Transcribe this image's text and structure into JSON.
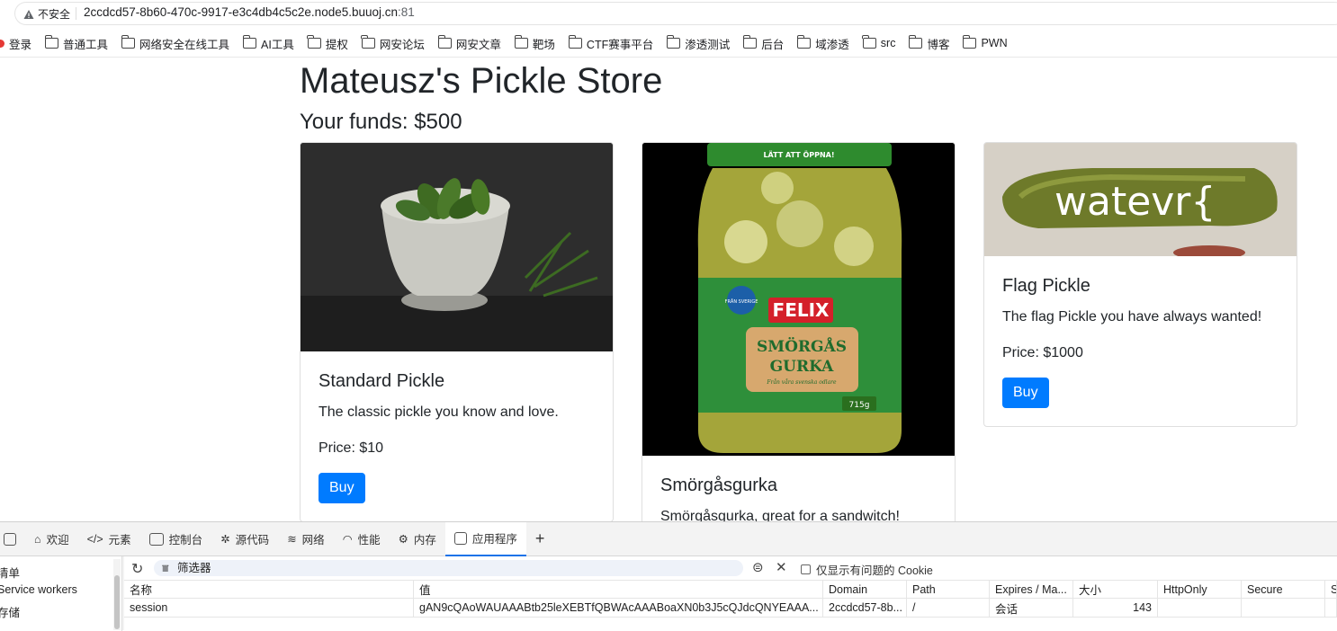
{
  "browser": {
    "security_label": "不安全",
    "url_host": "2ccdcd57-8b60-470c-9917-e3c4db4c5c2e.node5.buuoj.cn",
    "url_port": ":81"
  },
  "bookmarks": [
    {
      "label": "登录"
    },
    {
      "label": "普通工具"
    },
    {
      "label": "网络安全在线工具"
    },
    {
      "label": "AI工具"
    },
    {
      "label": "提权"
    },
    {
      "label": "网安论坛"
    },
    {
      "label": "网安文章"
    },
    {
      "label": "靶场"
    },
    {
      "label": "CTF赛事平台"
    },
    {
      "label": "渗透测试"
    },
    {
      "label": "后台"
    },
    {
      "label": "域渗透"
    },
    {
      "label": "src"
    },
    {
      "label": "博客"
    },
    {
      "label": "PWN"
    }
  ],
  "page": {
    "title": "Mateusz's Pickle Store",
    "funds": "Your funds: $500",
    "products": [
      {
        "name": "Standard Pickle",
        "desc": "The classic pickle you know and love.",
        "price": "Price: $10",
        "buy": "Buy"
      },
      {
        "name": "Smörgåsgurka",
        "desc": "Smörgåsgurka, great for a sandwitch!",
        "jar_brand": "FELIX",
        "jar_line1": "SMÖRGÅS",
        "jar_line2": "GURKA",
        "jar_sub": "Från våra svenska odlare",
        "jar_badge": "FRÅN SVERIGE",
        "jar_weight": "715g",
        "jar_lid": "LÄTT ATT ÖPPNA!"
      },
      {
        "name": "Flag Pickle",
        "desc": "The flag Pickle you have always wanted!",
        "price": "Price: $1000",
        "buy": "Buy",
        "image_text": "watevr{"
      }
    ]
  },
  "devtools": {
    "tabs": [
      {
        "label": "欢迎",
        "icon": "home-icon"
      },
      {
        "label": "元素",
        "icon": "code-icon"
      },
      {
        "label": "控制台",
        "icon": "console-icon"
      },
      {
        "label": "源代码",
        "icon": "bug-icon"
      },
      {
        "label": "网络",
        "icon": "wifi-icon"
      },
      {
        "label": "性能",
        "icon": "gauge-icon"
      },
      {
        "label": "内存",
        "icon": "gear-icon"
      },
      {
        "label": "应用程序",
        "icon": "app-icon"
      }
    ],
    "sidebar": [
      "清单",
      "Service workers",
      "存储"
    ],
    "filter_placeholder": "筛选器",
    "only_issues_label": "仅显示有问题的 Cookie",
    "columns": [
      "名称",
      "值",
      "Domain",
      "Path",
      "Expires / Ma...",
      "大小",
      "HttpOnly",
      "Secure",
      "S"
    ],
    "cookie": {
      "name": "session",
      "value": "gAN9cQAoWAUAAABtb25leXEBTfQBWAcAAABoaXN0b3J5cQJdcQNYEAAA...",
      "domain": "2ccdcd57-8b...",
      "path": "/",
      "expires": "会话",
      "size": "143",
      "httponly": "",
      "secure": ""
    }
  }
}
